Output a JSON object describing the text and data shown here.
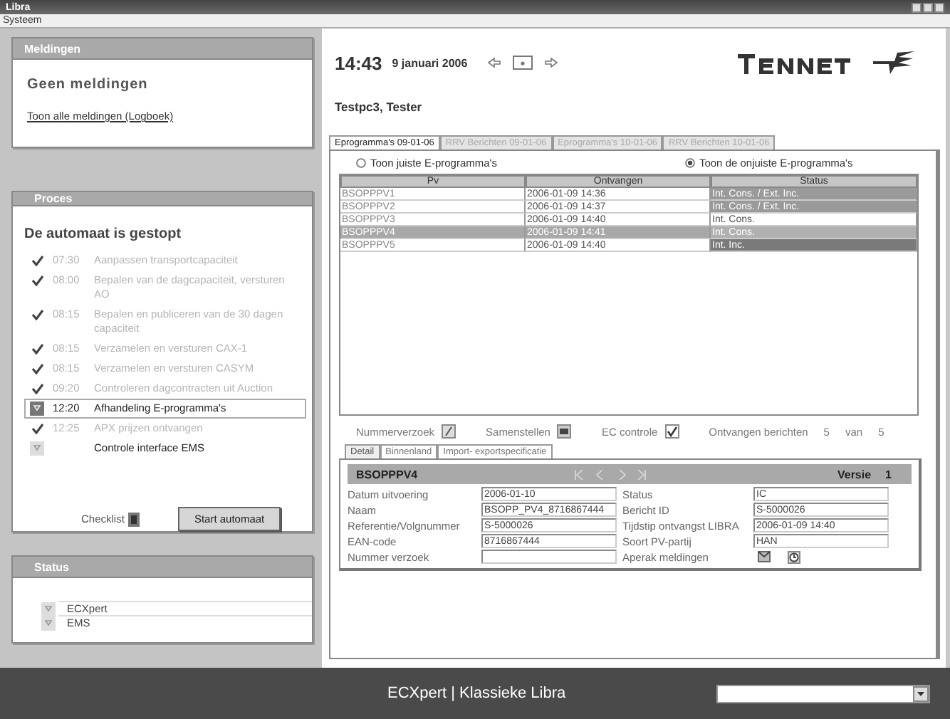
{
  "window": {
    "title": "Libra"
  },
  "menu": [
    "Systeem"
  ],
  "meldingen": {
    "title": "Meldingen",
    "message": "Geen meldingen",
    "link": "Toon alle meldingen (Logboek)"
  },
  "proces": {
    "title": "Proces",
    "heading": "De automaat is gestopt",
    "steps": [
      {
        "time": "07:30",
        "label": "Aanpassen transportcapaciteit",
        "kind": "done"
      },
      {
        "time": "08:00",
        "label": "Bepalen van de dagcapaciteit, versturen AO",
        "kind": "done"
      },
      {
        "time": "08:15",
        "label": "Bepalen en publiceren van de 30 dagen capaciteit",
        "kind": "done"
      },
      {
        "time": "08:15",
        "label": "Verzamelen en versturen CAX-1",
        "kind": "done"
      },
      {
        "time": "08:15",
        "label": "Verzamelen en versturen CASYM",
        "kind": "done"
      },
      {
        "time": "09:20",
        "label": "Controleren dagcontracten uit Auction",
        "kind": "done"
      },
      {
        "time": "12:20",
        "label": "Afhandeling E-programma's",
        "kind": "active"
      },
      {
        "time": "12:25",
        "label": "APX prijzen ontvangen",
        "kind": "done"
      },
      {
        "label": "Controle interface EMS",
        "kind": "pending"
      }
    ],
    "checklist": "Checklist",
    "start_button": "Start automaat"
  },
  "status": {
    "title": "Status",
    "items": [
      "ECXpert",
      "EMS"
    ]
  },
  "header": {
    "time": "14:43",
    "date": "9 januari 2006",
    "user": "Testpc3, Tester"
  },
  "tabs": [
    {
      "label": "Eprogramma's 09-01-06",
      "selected": true
    },
    {
      "label": "RRV Berichten 09-01-06",
      "selected": false
    },
    {
      "label": "Eprogramma's 10-01-06",
      "selected": false
    },
    {
      "label": "RRV Berichten 10-01-06",
      "selected": false
    }
  ],
  "radios": [
    {
      "label": "Toon juiste E-programma's",
      "selected": false
    },
    {
      "label": "Toon de onjuiste E-programma's",
      "selected": true
    }
  ],
  "table": {
    "columns": [
      "Pv",
      "Ontvangen",
      "Status"
    ],
    "rows": [
      {
        "pv": "BSOPPPV1",
        "received": "2006-01-09 14:36",
        "status": "Int. Cons. / Ext. Inc.",
        "color": "#9a9a9a",
        "selected": false
      },
      {
        "pv": "BSOPPPV2",
        "received": "2006-01-09 14:37",
        "status": "Int. Cons. / Ext. Inc.",
        "color": "#9a9a9a",
        "selected": false
      },
      {
        "pv": "BSOPPPV3",
        "received": "2006-01-09 14:40",
        "status": "Int. Cons.",
        "color": "#ffffff",
        "selected": false
      },
      {
        "pv": "BSOPPPV4",
        "received": "2006-01-09 14:41",
        "status": "Int. Cons.",
        "color": "#b0b0b0",
        "selected": true
      },
      {
        "pv": "BSOPPPV5",
        "received": "2006-01-09 14:40",
        "status": "Int. Inc.",
        "color": "#7a7a7a",
        "selected": false
      }
    ]
  },
  "toolbar": {
    "number_request": "Nummerverzoek",
    "compose": "Samenstellen",
    "ec_check": "EC controle",
    "ec_checked": true,
    "received_label": "Ontvangen berichten",
    "received": "5",
    "of": "van",
    "total": "5"
  },
  "detail_tabs": [
    {
      "label": "Detail",
      "selected": true
    },
    {
      "label": "Binnenland",
      "selected": false
    },
    {
      "label": "Import- exportspecificatie",
      "selected": false
    }
  ],
  "detail": {
    "title": "BSOPPPV4",
    "version_label": "Versie",
    "version": "1",
    "fields_left": [
      {
        "label": "Datum uitvoering",
        "value": "2006-01-10"
      },
      {
        "label": "Naam",
        "value": "BSOPP_PV4_8716867444"
      },
      {
        "label": "Referentie/Volgnummer",
        "value": "S-5000026"
      },
      {
        "label": "EAN-code",
        "value": "8716867444"
      },
      {
        "label": "Nummer verzoek"
      }
    ],
    "fields_right": [
      {
        "label": "Status",
        "value": "IC"
      },
      {
        "label": "Bericht ID",
        "value": "S-5000026"
      },
      {
        "label": "Tijdstip ontvangst LIBRA",
        "value": "2006-01-09 14:40"
      },
      {
        "label": "Soort PV-partij",
        "value": "HAN"
      },
      {
        "label": "Aperak meldingen",
        "kind": "icons"
      }
    ]
  },
  "footer": {
    "text": "ECXpert | Klassieke Libra"
  }
}
